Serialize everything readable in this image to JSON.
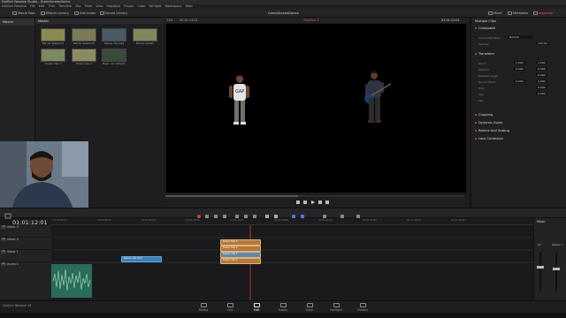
{
  "window": {
    "title": "DaVinci Resolve Studio - GreenScreenDance"
  },
  "menu": [
    "DaVinci Resolve",
    "File",
    "Edit",
    "Trim",
    "Timeline",
    "Clip",
    "Mark",
    "View",
    "Playback",
    "Fusion",
    "Color",
    "Fairlight",
    "Workspace",
    "Help"
  ],
  "toolbar": {
    "media_pool": "Media Pool",
    "effects_library": "Effects Library",
    "edit_index": "Edit Index",
    "sound_library": "Sound Library",
    "project_name": "GreenScreenDance",
    "mixer": "Mixer",
    "metadata": "Metadata",
    "inspector": "Inspector"
  },
  "media_pool": {
    "sidebar_label": "Master",
    "bin_label": "Master",
    "clips": [
      {
        "label": "Barrier Splash 03",
        "color": "#8a8a52"
      },
      {
        "label": "Barrier Splash 03",
        "color": "#7a7a55"
      },
      {
        "label": "Sleeve clip.mp4",
        "color": "#4a5a66"
      },
      {
        "label": "Barrier Splash",
        "color": "#7e8a5e"
      },
      {
        "label": "Fusion Clip 1",
        "color": "#7c8a60"
      },
      {
        "label": "Fusion Clip 2",
        "color": "#8c8a60"
      },
      {
        "label": "Bass - Ani 50 bpm",
        "color": "#3a4a3a"
      }
    ]
  },
  "viewer": {
    "zoom": "73%",
    "source_timecode": "00:01:13:21",
    "project_name": "GreenScreenDance",
    "timeline_name": "Timeline 1",
    "timecode": "01:01:12:01"
  },
  "inspector": {
    "title": "Multiple Clips",
    "sections": {
      "composite": "Composite",
      "transform": "Transform",
      "cropping": "Cropping",
      "dynamic_zoom": "Dynamic Zoom",
      "retime": "Retime And Scaling",
      "lens": "Lens Correction"
    },
    "composite_mode_label": "Composite Mode",
    "composite_mode_value": "Normal",
    "opacity_label": "Opacity",
    "opacity_value": "100.00",
    "zoom_label": "Zoom",
    "zoom_x": "1.000",
    "zoom_y": "1.000",
    "position_label": "Position",
    "position_x": "0.000",
    "position_y": "0.000",
    "rotation_label": "Rotation Angle",
    "rotation_value": "0.000",
    "anchor_label": "Anchor Point",
    "anchor_x": "0.000",
    "anchor_y": "0.000",
    "pitch_label": "Pitch",
    "pitch_value": "0.000",
    "yaw_label": "Yaw",
    "yaw_value": "0.000",
    "flip_label": "Flip"
  },
  "timeline": {
    "timecode": "01:01:12:01",
    "tracks": [
      {
        "id": "V3",
        "name": "Video 3"
      },
      {
        "id": "V2",
        "name": "Video 2"
      },
      {
        "id": "V1",
        "name": "Video 1"
      },
      {
        "id": "A1",
        "name": "Audio 1"
      }
    ],
    "ruler_marks": [
      "01:00:50:00",
      "01:00:56:00",
      "01:01:02:00",
      "01:01:08:00",
      "01:01:14:00",
      "01:01:20:00",
      "01:01:26:00",
      "01:01:32:00",
      "01:01:38:00",
      "01:01:44:00"
    ],
    "clips": [
      {
        "label": "Fusion Clip 2",
        "track": "V3"
      },
      {
        "label": "Fusion Clip 1",
        "track": "V2"
      },
      {
        "label": "Fusion Clip 1",
        "track": "V2b"
      },
      {
        "label": "Fusion Clip 2",
        "track": "V1b"
      },
      {
        "label": "Sleeve clip.mp4",
        "track": "V1"
      }
    ],
    "mixer_title": "Mixer",
    "mixer_channel": "A1",
    "mixer_master": "Master 1"
  },
  "pages": [
    "Media",
    "Cut",
    "Edit",
    "Fusion",
    "Color",
    "Fairlight",
    "Deliver"
  ],
  "active_page": "Edit",
  "footer_label": "DaVinci Resolve 16"
}
